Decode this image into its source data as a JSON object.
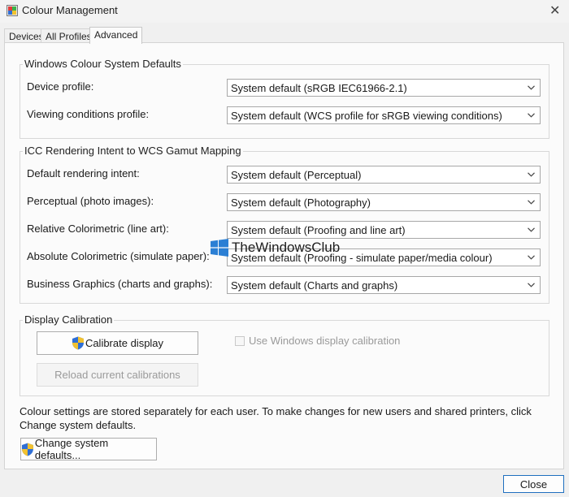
{
  "window": {
    "title": "Colour Management",
    "close_glyph": "✕"
  },
  "tabs": [
    {
      "label": "Devices",
      "active": false
    },
    {
      "label": "All Profiles",
      "active": false
    },
    {
      "label": "Advanced",
      "active": true
    }
  ],
  "wcs_defaults": {
    "title": "Windows Colour System Defaults",
    "rows": [
      {
        "label": "Device profile:",
        "value": "System default (sRGB IEC61966-2.1)"
      },
      {
        "label": "Viewing conditions profile:",
        "value": "System default (WCS profile for sRGB viewing conditions)"
      }
    ]
  },
  "icc_mapping": {
    "title": "ICC Rendering Intent to WCS Gamut Mapping",
    "rows": [
      {
        "label": "Default rendering intent:",
        "value": "System default (Perceptual)"
      },
      {
        "label": "Perceptual (photo images):",
        "value": "System default (Photography)"
      },
      {
        "label": "Relative Colorimetric (line art):",
        "value": "System default (Proofing and line art)"
      },
      {
        "label": "Absolute Colorimetric (simulate paper):",
        "value": "System default (Proofing - simulate paper/media colour)"
      },
      {
        "label": "Business Graphics (charts and graphs):",
        "value": "System default (Charts and graphs)"
      }
    ]
  },
  "calibration": {
    "title": "Display Calibration",
    "calibrate_button": "Calibrate display",
    "reload_button": "Reload current calibrations",
    "use_windows_calibration_label": "Use Windows display calibration",
    "use_windows_calibration_checked": false
  },
  "info_text": "Colour settings are stored separately for each user. To make changes for new users and shared printers, click Change system defaults.",
  "change_defaults_button": "Change system defaults...",
  "close_button": "Close",
  "watermark": "TheWindowsClub",
  "icons": {
    "app": "colour-management-icon",
    "shield": "uac-shield-icon",
    "chevron": "chevron-down-icon"
  },
  "colors": {
    "accent": "#1f6fbf",
    "watermark_logo": "#2b7fd4"
  }
}
